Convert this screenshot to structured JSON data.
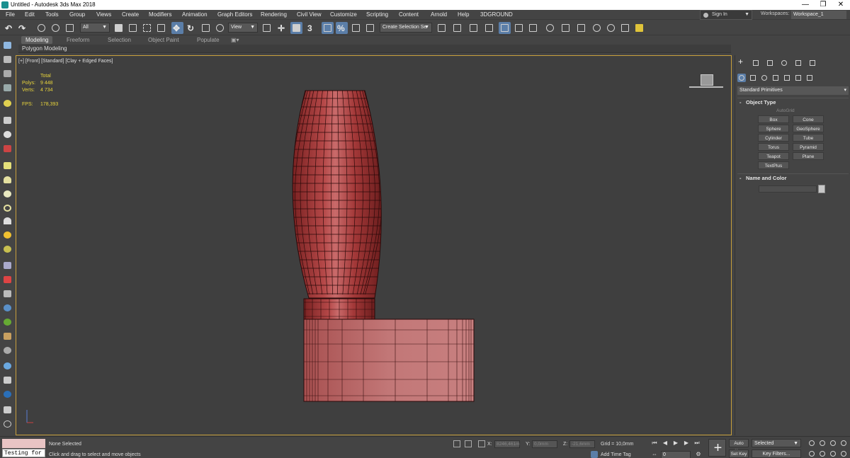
{
  "window": {
    "title": "Untitled - Autodesk 3ds Max 2018",
    "minimize": "—",
    "maximize": "❐",
    "close": "✕"
  },
  "menu": [
    "File",
    "Edit",
    "Tools",
    "Group",
    "Views",
    "Create",
    "Modifiers",
    "Animation",
    "Graph Editors",
    "Rendering",
    "Civil View",
    "Customize",
    "Scripting",
    "Content",
    "Arnold",
    "Help",
    "3DGROUND"
  ],
  "account": {
    "sign_in": "Sign In",
    "workspaces_label": "Workspaces:",
    "workspace": "Workspace_1"
  },
  "toolbar": {
    "filter": "All",
    "ref_coord": "View",
    "selection_set": "Create Selection Se"
  },
  "ribbon": {
    "tabs": [
      "Modeling",
      "Freeform",
      "Selection",
      "Object Paint",
      "Populate"
    ],
    "active_tab": "Modeling",
    "sub_label": "Polygon Modeling"
  },
  "viewport": {
    "label": "[+] [Front] [Standard] [Clay + Edged Faces]",
    "stats": {
      "header": "Total",
      "polys_label": "Polys:",
      "polys": "9 448",
      "verts_label": "Verts:",
      "verts": "4 734",
      "fps_label": "FPS:",
      "fps": "178,393"
    },
    "model_colors": {
      "body": "#a83434",
      "edge": "#2a0a0a",
      "box": "#c07070"
    }
  },
  "command_panel": {
    "category": "Standard Primitives",
    "object_type_title": "Object Type",
    "autogrid": "AutoGrid",
    "object_buttons": [
      "Box",
      "Cone",
      "Sphere",
      "GeoSphere",
      "Cylinder",
      "Tube",
      "Torus",
      "Pyramid",
      "Teapot",
      "Plane",
      "TextPlus"
    ],
    "name_color_title": "Name and Color",
    "rollout_sign": "-"
  },
  "status": {
    "maxscript": "Testing for :",
    "selection": "None Selected",
    "prompt": "Click and drag to select and move objects",
    "x_label": "X:",
    "x_value": "8246,461m",
    "y_label": "Y:",
    "y_value": "0,0mm",
    "z_label": "Z:",
    "z_value": "-21,6mm",
    "grid": "Grid = 10,0mm",
    "add_time_tag": "Add Time Tag",
    "frame": "0",
    "auto_key": "Auto Key",
    "set_key": "Set Key",
    "key_mode": "Selected",
    "key_filters": "Key Filters..."
  }
}
